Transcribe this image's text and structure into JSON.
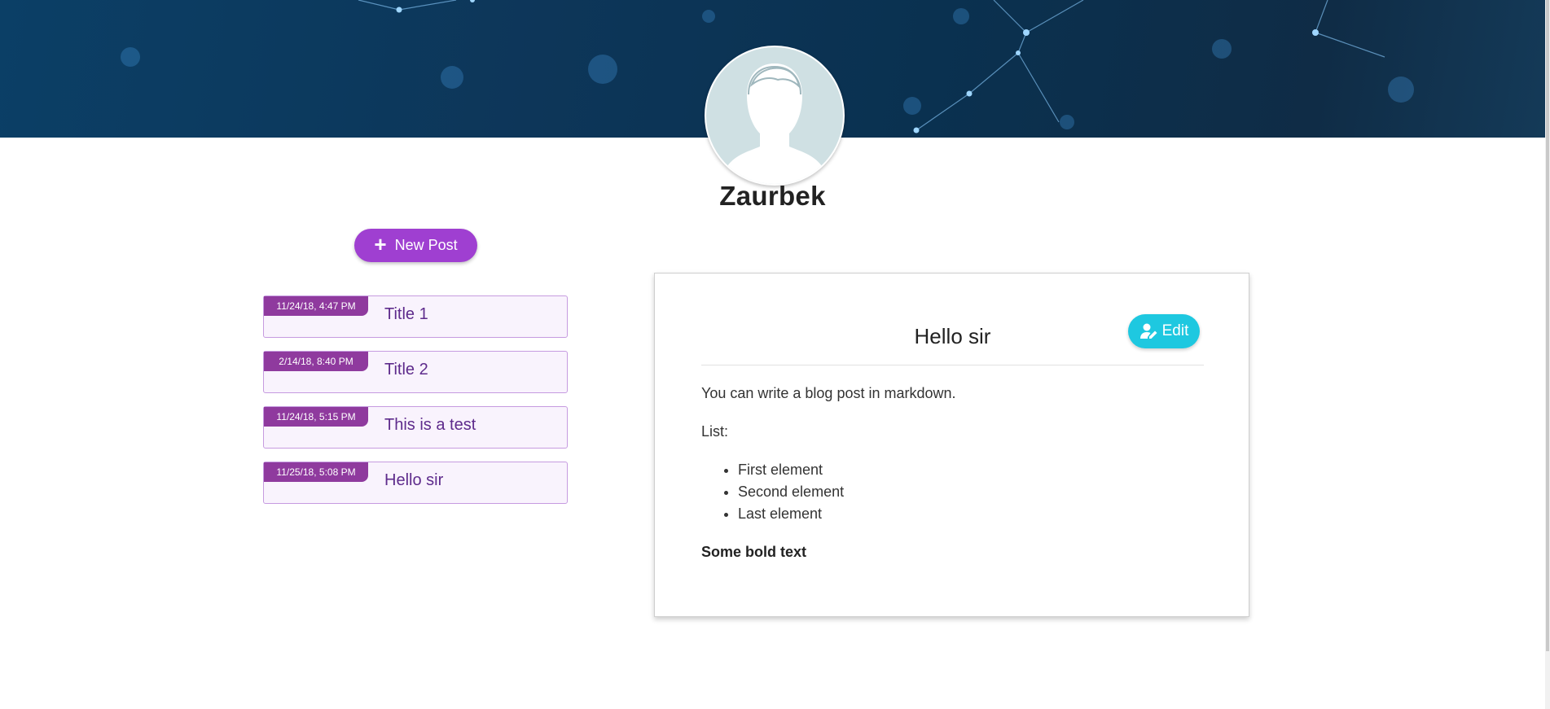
{
  "profile": {
    "name": "Zaurbek",
    "avatar_icon": "user-silhouette-icon"
  },
  "actions": {
    "new_post_label": "New Post",
    "new_post_icon": "plus-icon"
  },
  "posts": [
    {
      "date": "11/24/18, 4:47 PM",
      "title": "Title 1"
    },
    {
      "date": "2/14/18, 8:40 PM",
      "title": "Title 2"
    },
    {
      "date": "11/24/18, 5:15 PM",
      "title": "This is a test"
    },
    {
      "date": "11/25/18, 5:08 PM",
      "title": "Hello sir"
    }
  ],
  "selected_post": {
    "title": "Hello sir",
    "edit_label": "Edit",
    "edit_icon": "user-edit-icon",
    "intro": "You can write a blog post in markdown.",
    "list_label": "List:",
    "list_items": [
      "First element",
      "Second element",
      "Last element"
    ],
    "bold_text": "Some bold text"
  },
  "colors": {
    "accent_purple": "#9f3fd1",
    "date_badge": "#8f3a9e",
    "post_title": "#5e2b8c",
    "edit_cyan": "#1ec8e0",
    "banner_dark": "#0d3659"
  }
}
